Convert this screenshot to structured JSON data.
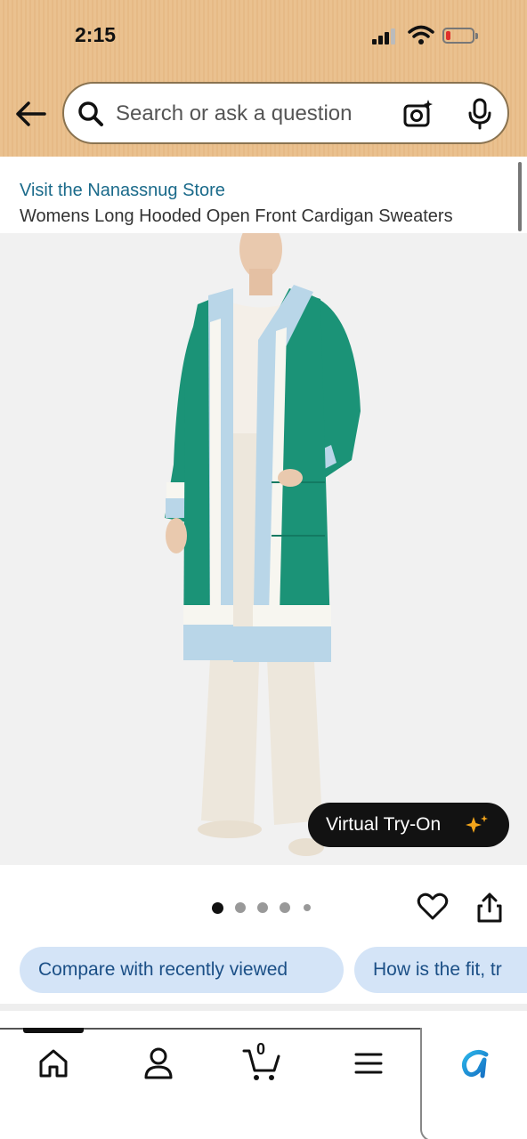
{
  "status_bar": {
    "time": "2:15",
    "battery_level": 0.1,
    "battery_color": "#e0302a"
  },
  "header": {
    "background": "#e8be8a",
    "back_icon": "arrow-left-icon",
    "search": {
      "placeholder": "Search or ask a question",
      "icons": [
        "search-icon",
        "camera-icon",
        "mic-icon"
      ]
    }
  },
  "product": {
    "store_link": "Visit the Nanassnug Store",
    "title": "Womens Long Hooded Open Front Cardigan Sweaters",
    "virtual_try_on_label": "Virtual Try-On",
    "image_count": 5,
    "active_image_index": 0,
    "colors": {
      "cardigan": "#1b9377",
      "trim_light": "#b9d6e8",
      "trim_white": "#f7f6f0"
    }
  },
  "actions": {
    "favorite_icon": "heart-icon",
    "share_icon": "share-icon"
  },
  "chips": [
    {
      "label": "Compare with recently viewed"
    },
    {
      "label": "How is the fit, tr"
    }
  ],
  "bottom_nav": {
    "items": [
      "home-icon",
      "account-icon",
      "cart-icon",
      "menu-icon",
      "rufus-icon"
    ],
    "cart_count": "0",
    "accent": "#1a9fd8"
  }
}
